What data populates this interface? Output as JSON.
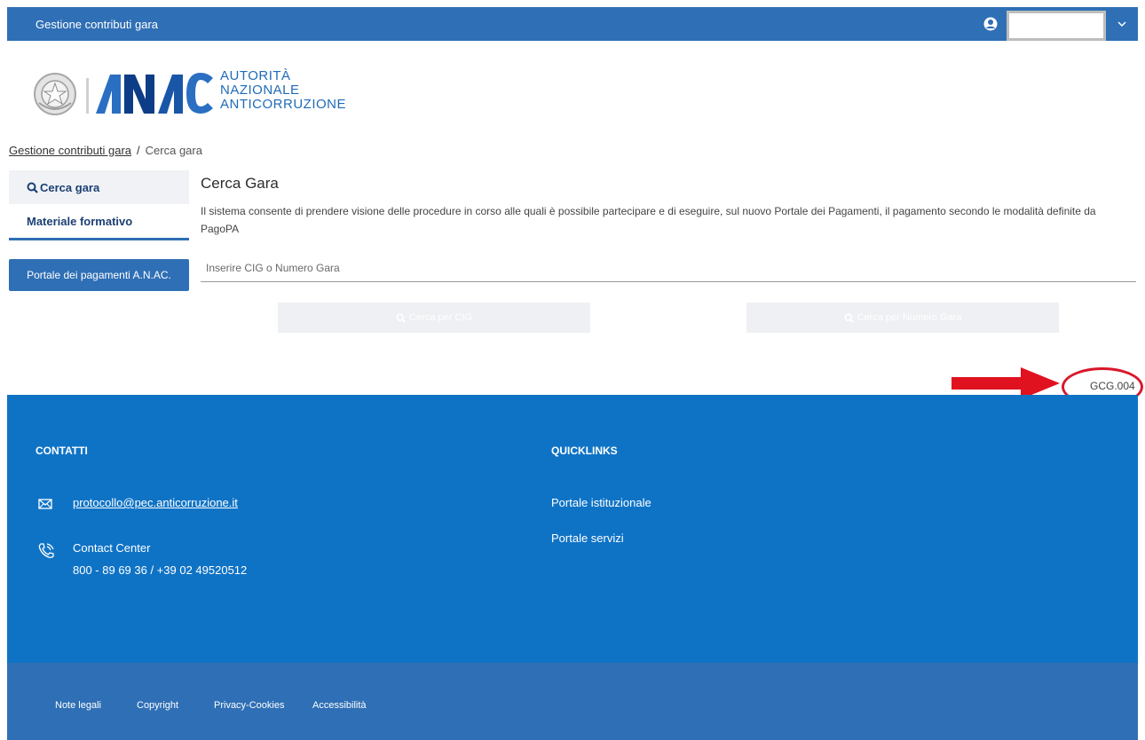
{
  "header": {
    "app_title": "Gestione contributi gara",
    "user_name": ""
  },
  "logo": {
    "line1": "AUTORITÀ",
    "line2": "NAZIONALE",
    "line3": "ANTICORRUZIONE"
  },
  "breadcrumb": {
    "root": "Gestione contributi gara",
    "separator": "/",
    "current": "Cerca gara"
  },
  "sidebar": {
    "items": [
      {
        "label": "Cerca gara"
      },
      {
        "label": "Materiale formativo"
      }
    ],
    "portal_button": "Portale dei pagamenti A.N.AC."
  },
  "main": {
    "title": "Cerca Gara",
    "description": "Il sistema consente di prendere visione delle procedure in corso alle quali è possibile partecipare e di eseguire, sul nuovo Portale dei Pagamenti, il pagamento secondo le modalità definite da PagoPA",
    "search_placeholder": "Inserire CIG o Numero Gara",
    "btn_cig": "Cerca per CIG",
    "btn_numero": "Cerca per Numero Gara"
  },
  "page_code": "GCG.004",
  "footer": {
    "contatti_title": "CONTATTI",
    "email": "protocollo@pec.anticorruzione.it",
    "contact_center": "Contact Center",
    "phone": "800 - 89 69 36 / +39 02 49520512",
    "quicklinks_title": "QUICKLINKS",
    "quicklinks": [
      {
        "label": "Portale istituzionale"
      },
      {
        "label": "Portale servizi"
      }
    ],
    "bottom_links": [
      {
        "label": "Note legali"
      },
      {
        "label": "Copyright"
      },
      {
        "label": "Privacy-Cookies"
      },
      {
        "label": "Accessibilità"
      }
    ]
  },
  "colors": {
    "topbar": "#2f6fb5",
    "footer": "#0f73c5",
    "footer_bottom": "#2f6fb5",
    "annotation_red": "#d9162a"
  },
  "icons": [
    "user-circle-icon",
    "chevron-down-icon",
    "search-icon",
    "mail-icon",
    "phone-icon",
    "emblem-icon",
    "red-arrow-icon"
  ]
}
